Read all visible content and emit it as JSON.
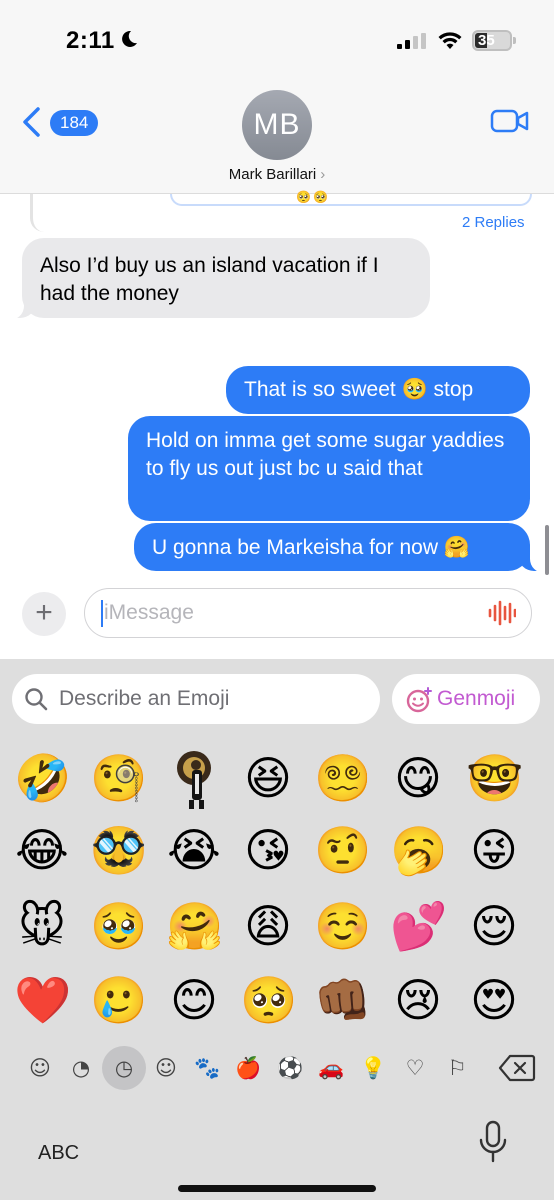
{
  "status_bar": {
    "time": "2:11",
    "battery": "35"
  },
  "header": {
    "back_count": "184",
    "avatar_initials": "MB",
    "contact_name": "Mark Barillari",
    "contact_chevron": "›"
  },
  "thread": {
    "replies_label": "2 Replies",
    "reply_card_emoji": "🥺🥺"
  },
  "messages": [
    {
      "direction": "incoming",
      "text": "Also I’d buy us an island vacation if I had the money"
    },
    {
      "direction": "outgoing",
      "text": "That is so sweet 🥹 stop"
    },
    {
      "direction": "outgoing",
      "text": "Hold on imma get some sugar yaddies to fly us out just bc u said that"
    },
    {
      "direction": "outgoing",
      "text": "U gonna be Markeisha for now 🤗"
    }
  ],
  "composer": {
    "placeholder": "iMessage",
    "plus_label": "+"
  },
  "emoji_keyboard": {
    "search_placeholder": "Describe an Emoji",
    "genmoji_label": "Genmoji",
    "recent_emoji": [
      [
        "🤣",
        "🧐",
        "",
        "😆",
        "😵‍💫",
        "😋",
        "🤓"
      ],
      [
        "😂",
        "🥸",
        "😭",
        "😘",
        "🤨",
        "🥱",
        "😜"
      ],
      [
        "🐭",
        "🥹",
        "🤗",
        "😩",
        "☺️",
        "💕",
        "😌"
      ],
      [
        "❤️",
        "🥲",
        "😊",
        "🥺",
        "👊🏾",
        "😢",
        "😍"
      ]
    ],
    "categories": [
      "memoji-icon",
      "sticker-icon",
      "recent-clock-icon",
      "smileys-icon",
      "animals-icon",
      "food-icon",
      "activity-icon",
      "travel-icon",
      "objects-icon",
      "symbols-icon",
      "flags-icon"
    ],
    "abc_label": "ABC"
  }
}
